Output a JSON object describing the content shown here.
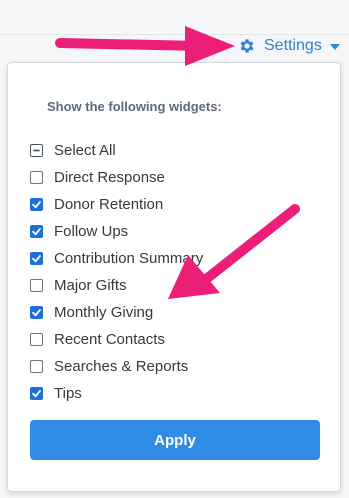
{
  "settings": {
    "label": "Settings",
    "icon": "gear-icon",
    "color": "#2f83d6"
  },
  "panel": {
    "title": "Show the following widgets:",
    "options": [
      {
        "label": "Select All",
        "state": "indeterminate"
      },
      {
        "label": "Direct Response",
        "state": "unchecked"
      },
      {
        "label": "Donor Retention",
        "state": "checked"
      },
      {
        "label": "Follow Ups",
        "state": "checked"
      },
      {
        "label": "Contribution Summary",
        "state": "checked"
      },
      {
        "label": "Major Gifts",
        "state": "unchecked"
      },
      {
        "label": "Monthly Giving",
        "state": "checked"
      },
      {
        "label": "Recent Contacts",
        "state": "unchecked"
      },
      {
        "label": "Searches & Reports",
        "state": "unchecked"
      },
      {
        "label": "Tips",
        "state": "checked"
      }
    ],
    "apply_label": "Apply"
  },
  "colors": {
    "accent": "#2f8ce4",
    "checkbox": "#1e6fd9",
    "annotation_arrow": "#ec1f78"
  }
}
